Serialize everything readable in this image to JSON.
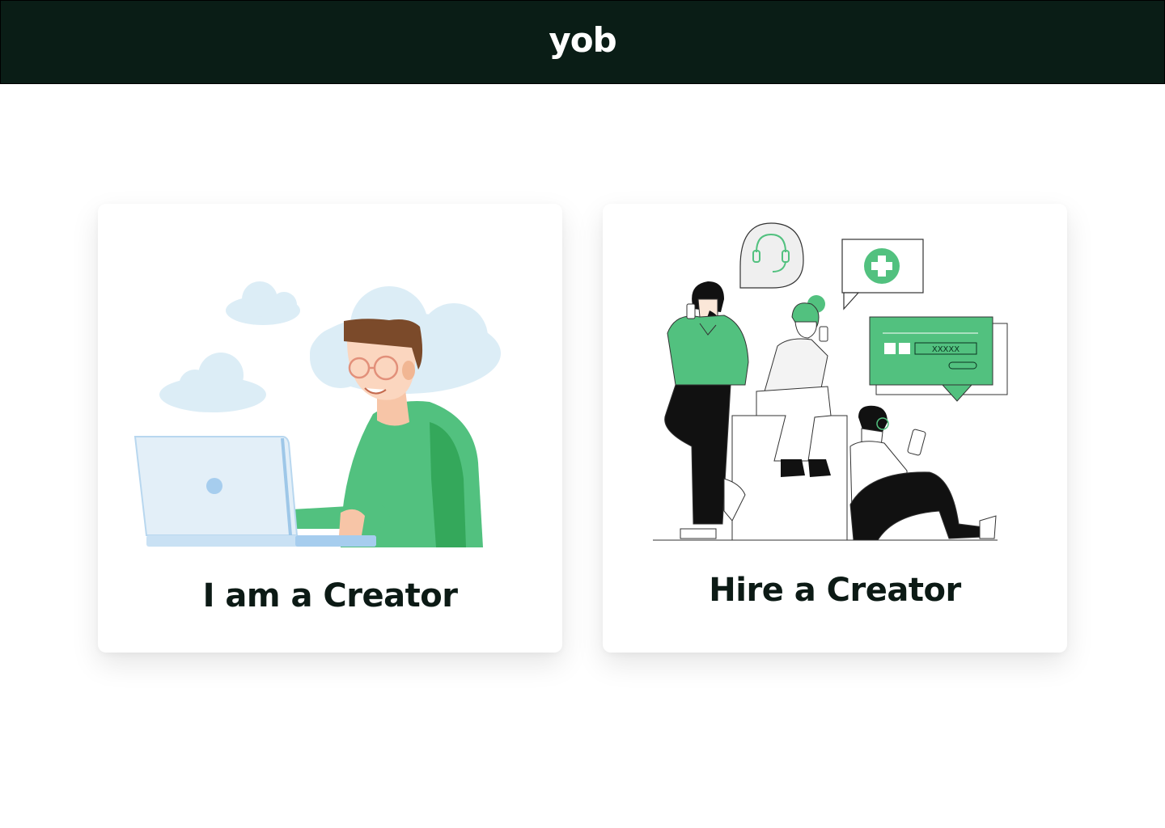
{
  "header": {
    "brand": "yob"
  },
  "cards": [
    {
      "label": "I am a Creator",
      "illustration": "creator-at-laptop-illustration"
    },
    {
      "label": "Hire a Creator",
      "illustration": "people-hiring-illustration"
    }
  ],
  "colors": {
    "header_bg": "#0a1d16",
    "accent_green": "#52c17f",
    "text_dark": "#0c1a15"
  },
  "illustration_text": {
    "password_mask": "XXXXX"
  }
}
